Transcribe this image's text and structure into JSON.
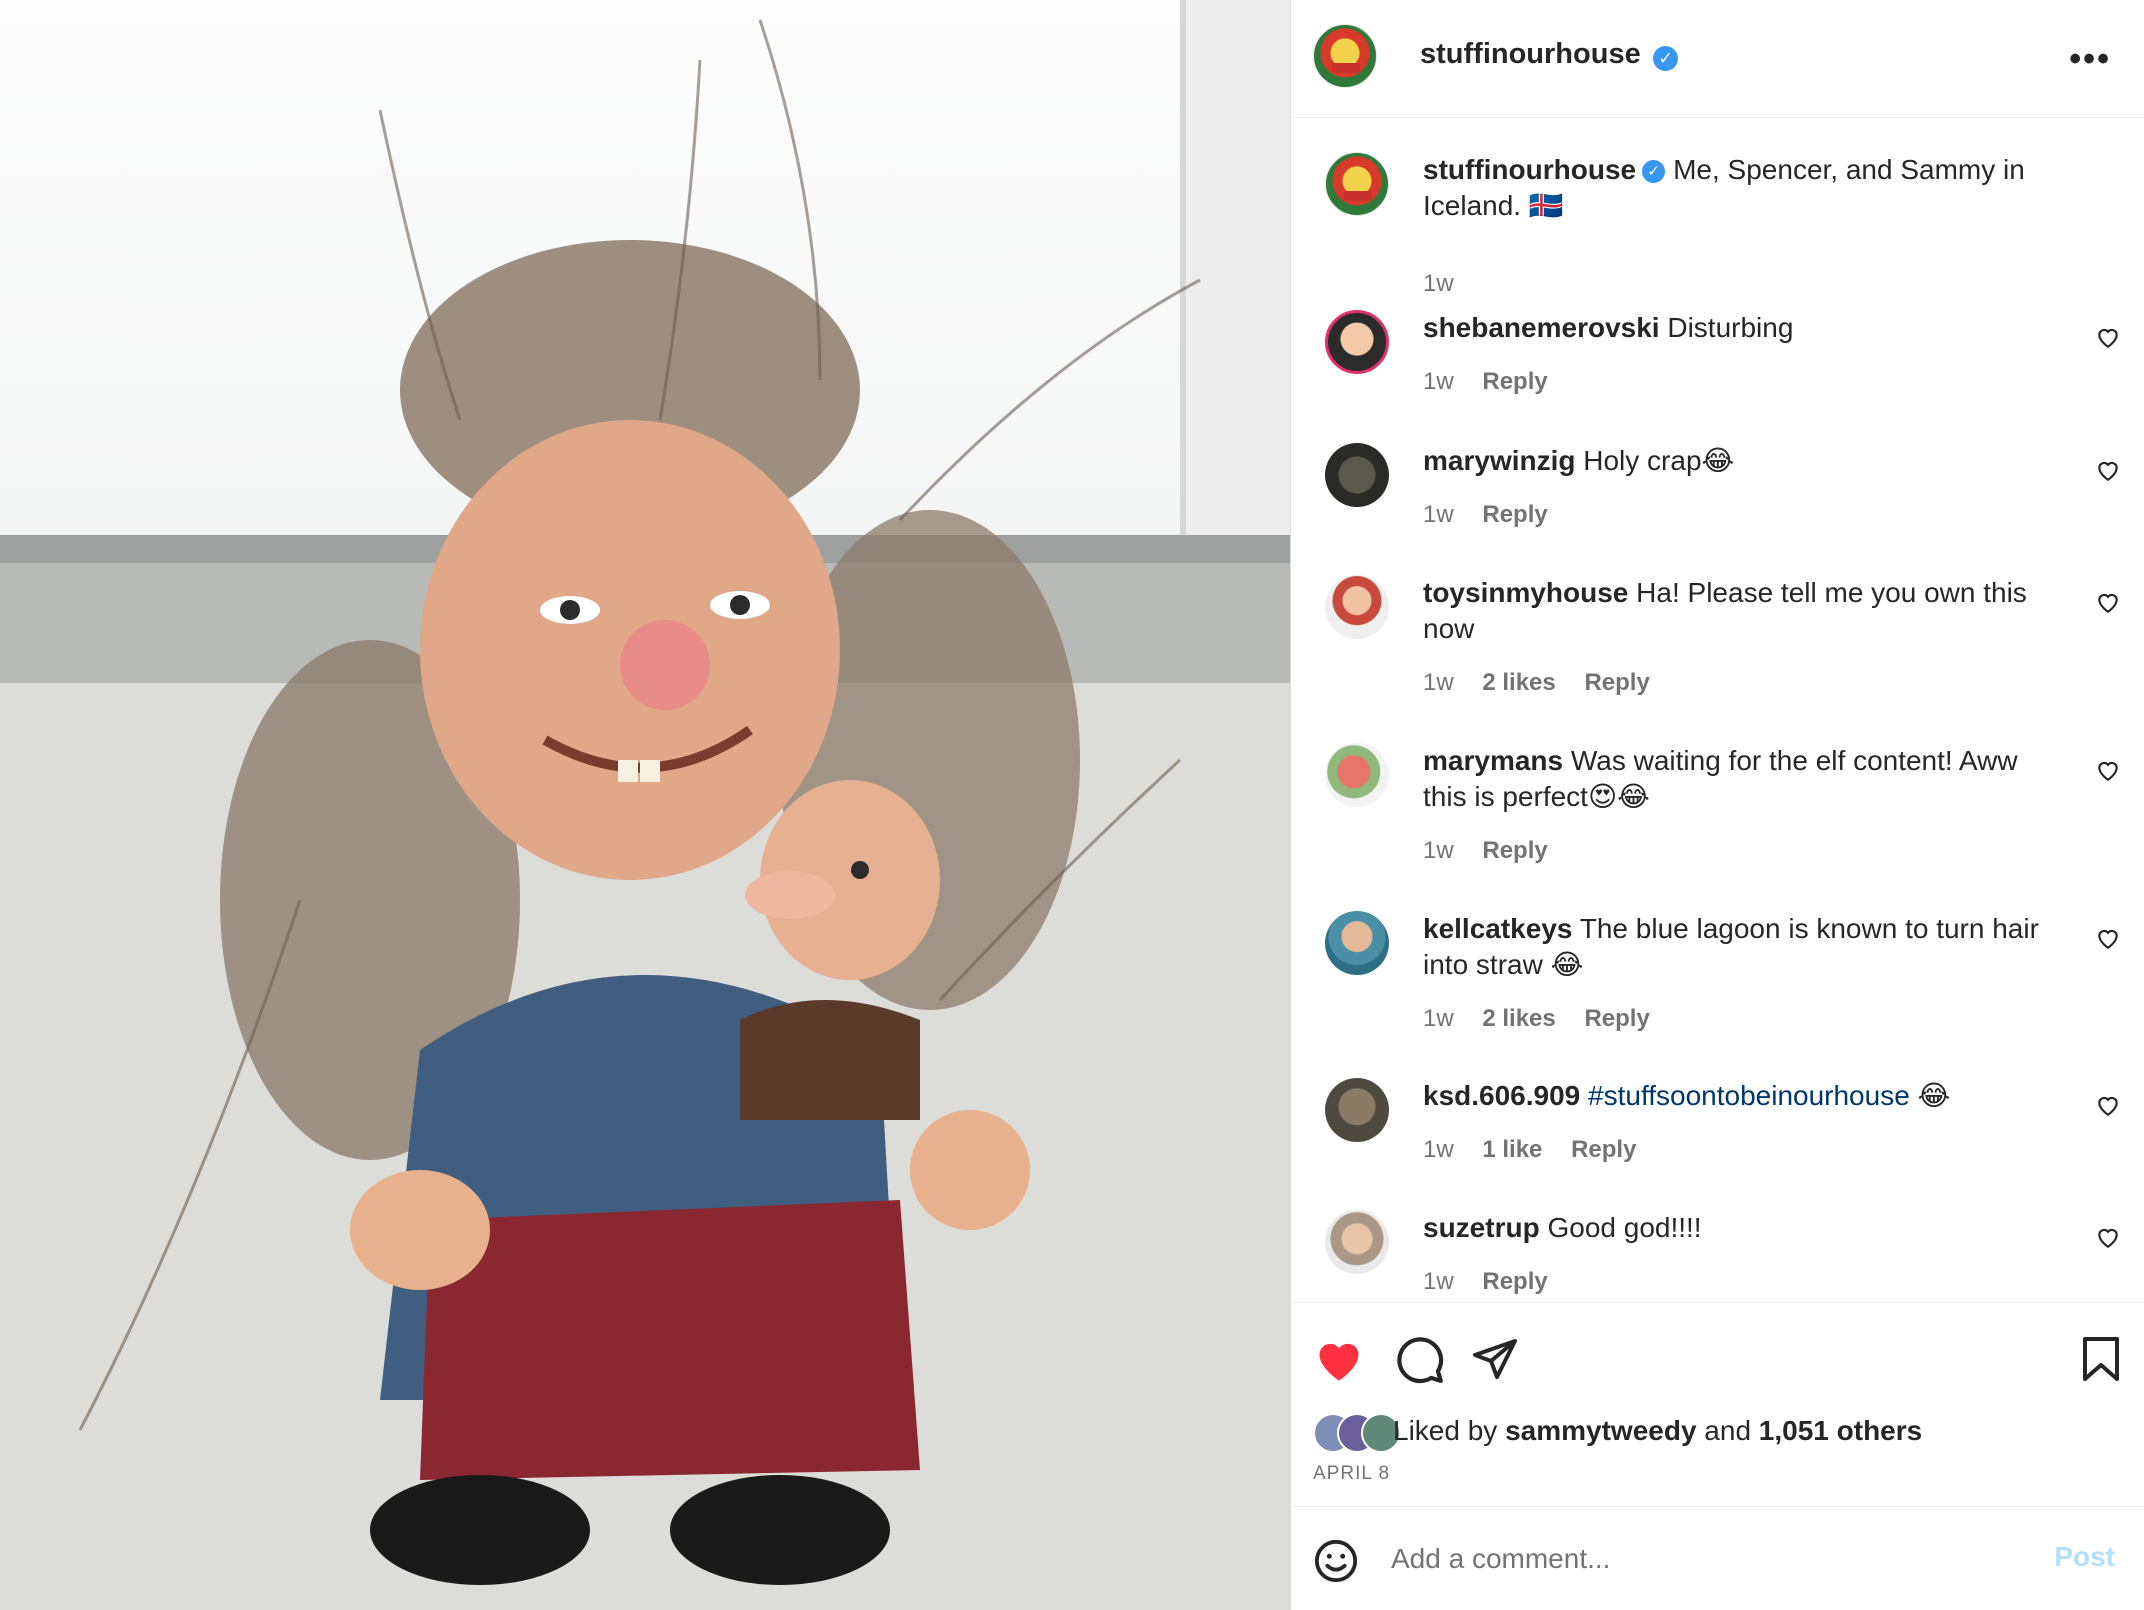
{
  "photo": {
    "alt_subject": "troll figurine photo"
  },
  "header": {
    "username": "stuffinourhouse",
    "verified": "✓",
    "more": "•••"
  },
  "caption": {
    "username": "stuffinourhouse",
    "text": "Me, Spencer, and Sammy in Iceland. 🇮🇸",
    "time": "1w"
  },
  "comments": [
    {
      "user": "shebanemerovski",
      "text": "Disturbing",
      "time": "1w",
      "likes": "",
      "reply": "Reply"
    },
    {
      "user": "marywinzig",
      "text": "Holy crap😂",
      "time": "1w",
      "likes": "",
      "reply": "Reply"
    },
    {
      "user": "toysinmyhouse",
      "text": "Ha! Please tell me you own this now",
      "time": "1w",
      "likes": "2 likes",
      "reply": "Reply"
    },
    {
      "user": "marymans",
      "text": "Was waiting for the elf content! Aww this is perfect😍😂",
      "time": "1w",
      "likes": "",
      "reply": "Reply"
    },
    {
      "user": "kellcatkeys",
      "text": "The blue lagoon is known to turn hair into straw 😂",
      "time": "1w",
      "likes": "2 likes",
      "reply": "Reply"
    },
    {
      "user": "ksd.606.909",
      "text": "",
      "hashtag": "#stuffsoontobeinourhouse",
      "tail": " 😂",
      "time": "1w",
      "likes": "1 like",
      "reply": "Reply"
    },
    {
      "user": "suzetrup",
      "text": "Good god!!!!",
      "time": "1w",
      "likes": "",
      "reply": "Reply"
    }
  ],
  "likes": {
    "prefix": "Liked by ",
    "user": "sammytweedy",
    "middle": " and ",
    "count": "1,051 others"
  },
  "date": "APRIL 8",
  "composer": {
    "placeholder": "Add a comment...",
    "post_label": "Post"
  },
  "colors": {
    "accent": "#0095f6",
    "like_red": "#ff3040",
    "post_disabled": "#b2dffc"
  }
}
